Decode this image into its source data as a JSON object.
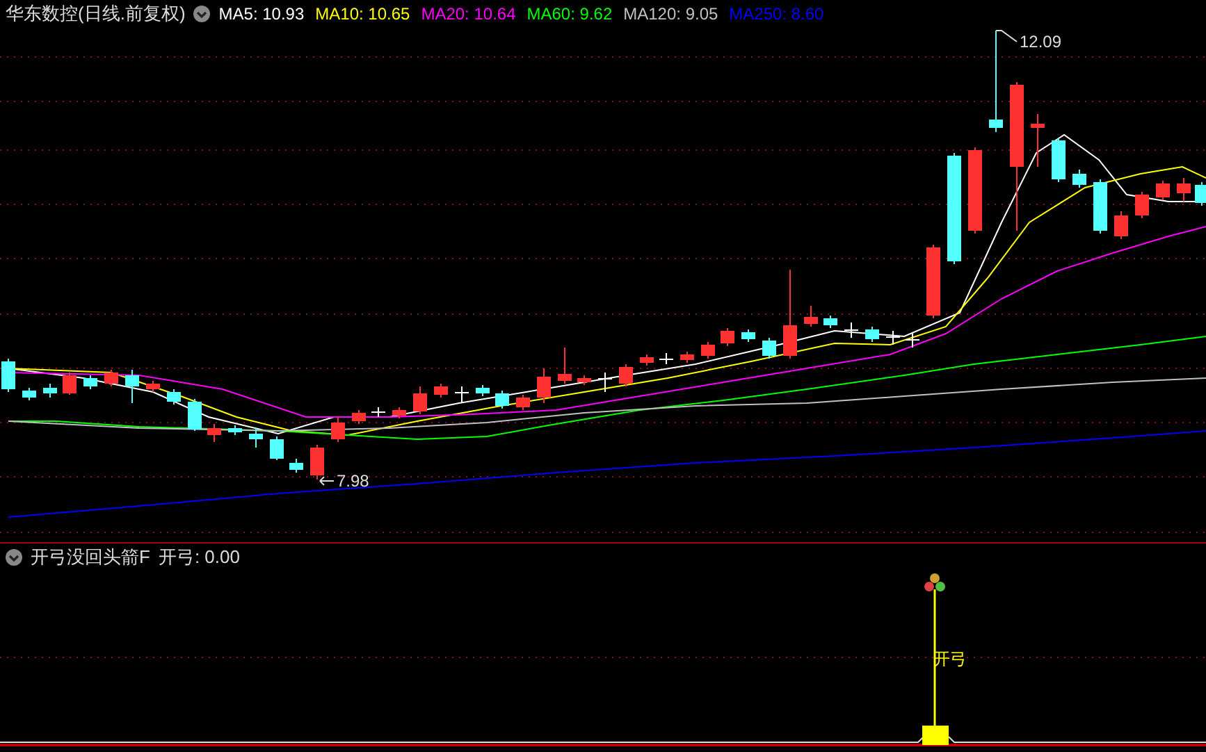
{
  "main_panel": {
    "title": "华东数控(日线.前复权)",
    "ma_legend": [
      {
        "label": "MA5: 10.93",
        "color": "#ffffff"
      },
      {
        "label": "MA10: 10.65",
        "color": "#ffff00"
      },
      {
        "label": "MA20: 10.64",
        "color": "#ff00ff"
      },
      {
        "label": "MA60: 9.62",
        "color": "#00ff00"
      },
      {
        "label": "MA120: 9.05",
        "color": "#c0c0c0"
      },
      {
        "label": "MA250: 8.60",
        "color": "#0000ff"
      }
    ],
    "high_label": "12.09",
    "low_label": "7.98"
  },
  "indicator_panel": {
    "title": "开弓没回头箭F",
    "reading": "开弓: 0.00",
    "signal_label": "开弓"
  }
}
